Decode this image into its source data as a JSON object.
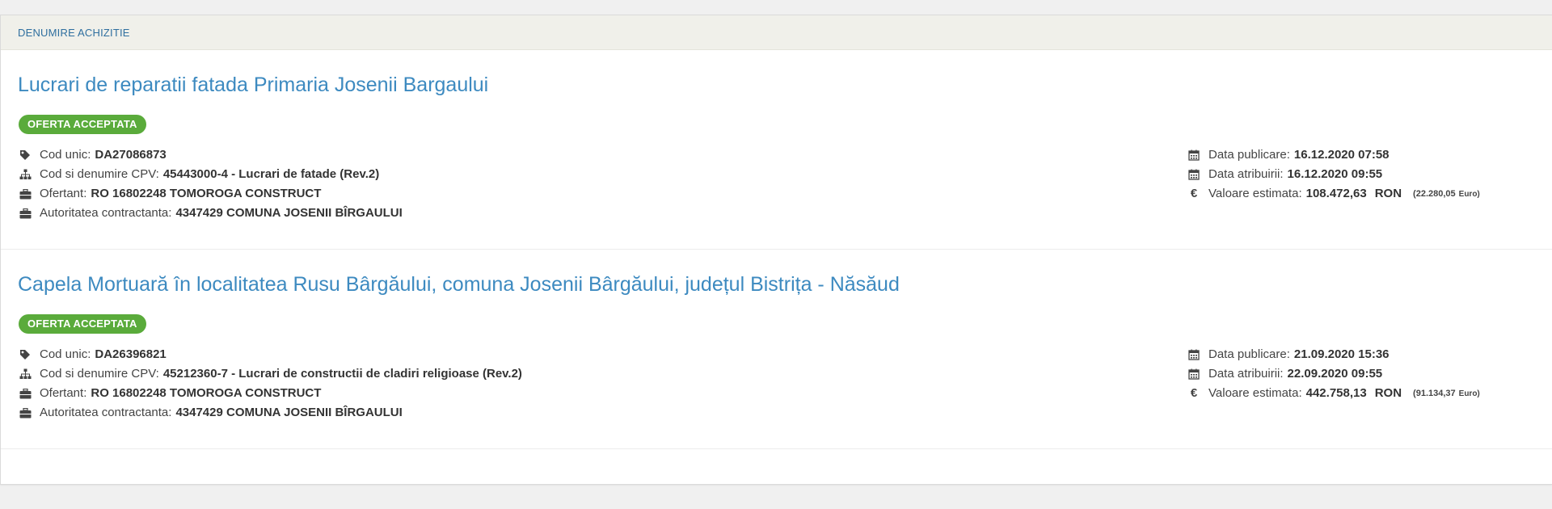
{
  "section_header": "DENUMIRE ACHIZITIE",
  "labels": {
    "cod_unic": "Cod unic:",
    "cpv": "Cod si denumire CPV:",
    "ofertant": "Ofertant:",
    "autoritate": "Autoritatea contractanta:",
    "data_publicare": "Data publicare:",
    "data_atribuirii": "Data atribuirii:",
    "valoare": "Valoare estimata:",
    "euro_symbol": "€"
  },
  "icons": {
    "cod_unic": "tag-icon",
    "cpv": "sitemap-icon",
    "ofertant": "briefcase-icon",
    "autoritate": "briefcase-icon",
    "dates": "calendar-icon",
    "valoare": "euro-icon"
  },
  "colors": {
    "title": "#3d8ac0",
    "badge": "#5aab3b",
    "header_bg": "#f0f0ea",
    "header_text": "#2f6f9f"
  },
  "items": [
    {
      "title": "Lucrari de reparatii fatada Primaria Josenii Bargaului",
      "status": "OFERTA ACCEPTATA",
      "cod_unic": "DA27086873",
      "cpv": "45443000-4 - Lucrari de fatade (Rev.2)",
      "ofertant": "RO 16802248 TOMOROGA CONSTRUCT",
      "autoritate": "4347429 COMUNA JOSENII BÎRGAULUI",
      "data_publicare": "16.12.2020 07:58",
      "data_atribuirii": "16.12.2020 09:55",
      "valoare_ron": "108.472,63",
      "currency": "RON",
      "valoare_euro": "(22.280,05",
      "euro_unit": "Euro)"
    },
    {
      "title": "Capela Mortuară în localitatea Rusu Bârgăului, comuna Josenii Bârgăului, județul Bistrița - Năsăud",
      "status": "OFERTA ACCEPTATA",
      "cod_unic": "DA26396821",
      "cpv": "45212360-7 - Lucrari de constructii de cladiri religioase (Rev.2)",
      "ofertant": "RO 16802248 TOMOROGA CONSTRUCT",
      "autoritate": "4347429 COMUNA JOSENII BÎRGAULUI",
      "data_publicare": "21.09.2020 15:36",
      "data_atribuirii": "22.09.2020 09:55",
      "valoare_ron": "442.758,13",
      "currency": "RON",
      "valoare_euro": "(91.134,37",
      "euro_unit": "Euro)"
    }
  ]
}
